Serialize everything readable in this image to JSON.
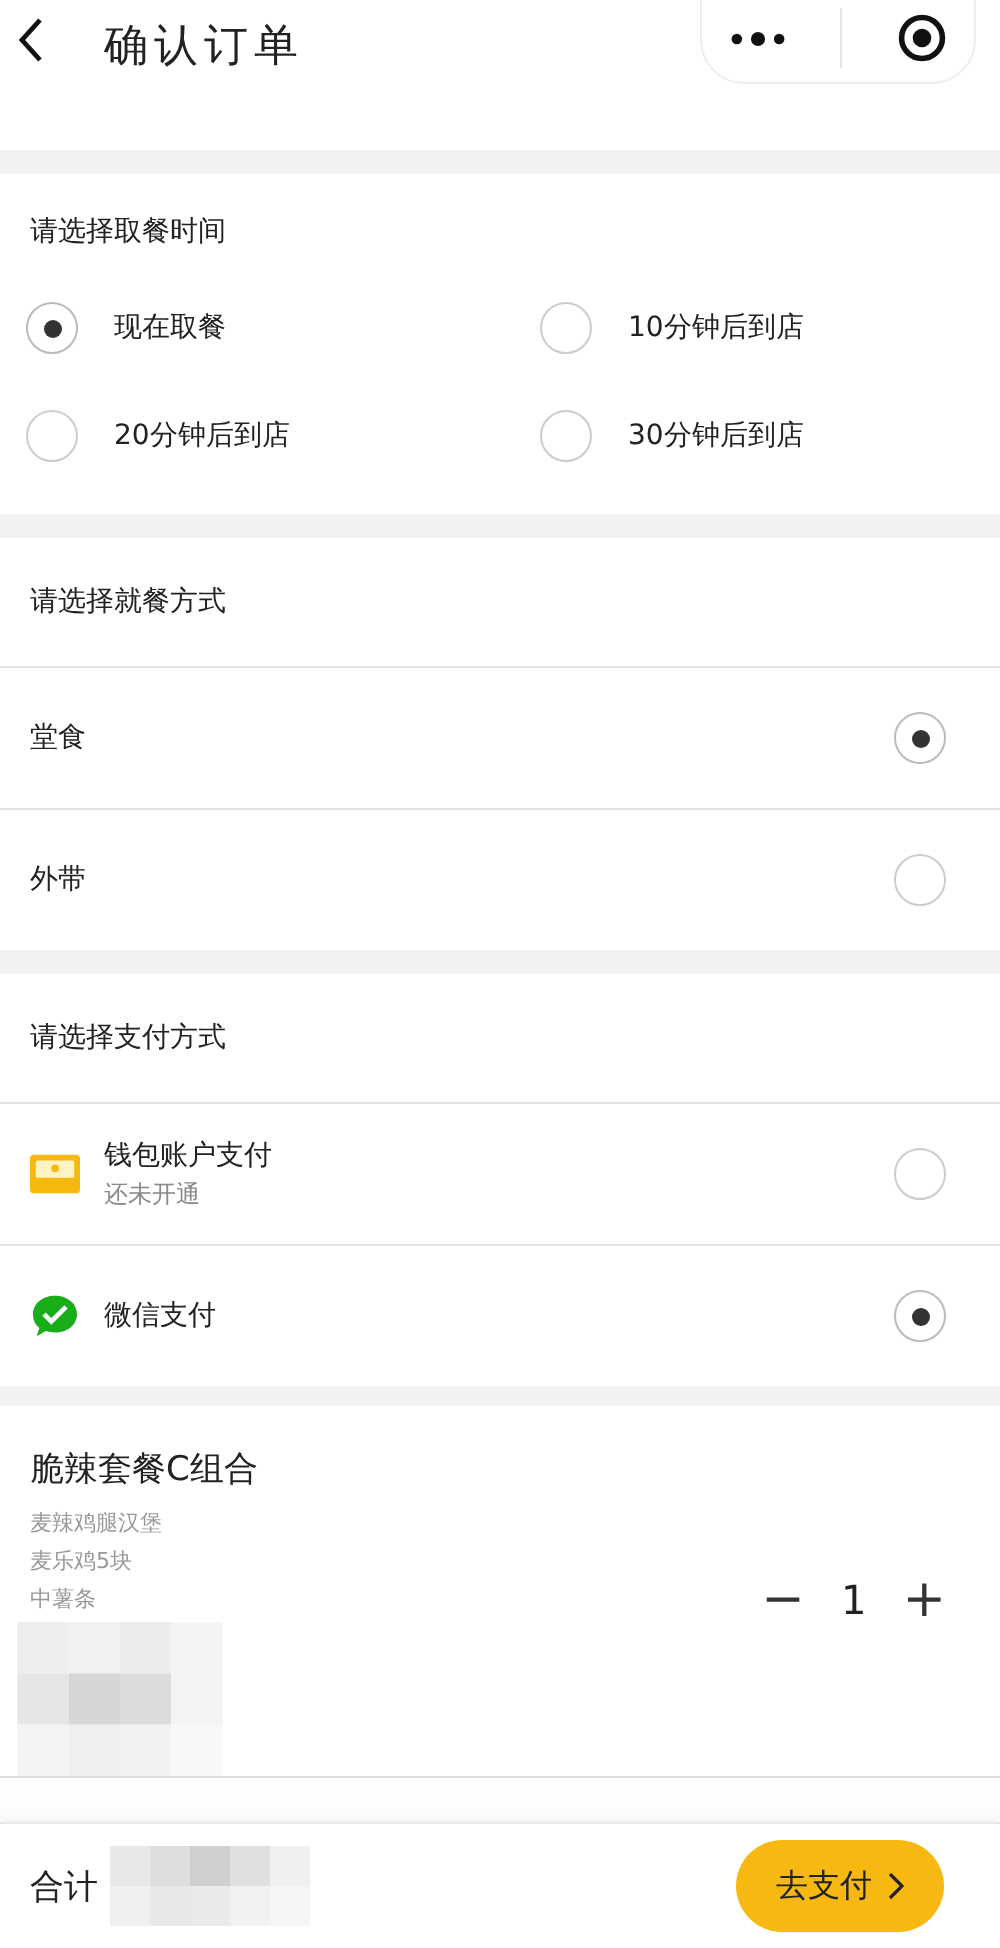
{
  "header": {
    "title": "确认订单"
  },
  "pickup_time": {
    "heading": "请选择取餐时间",
    "options": [
      {
        "label": "现在取餐",
        "selected": true
      },
      {
        "label": "10分钟后到店",
        "selected": false
      },
      {
        "label": "20分钟后到店",
        "selected": false
      },
      {
        "label": "30分钟后到店",
        "selected": false
      }
    ]
  },
  "dining_mode": {
    "heading": "请选择就餐方式",
    "options": [
      {
        "label": "堂食",
        "selected": true
      },
      {
        "label": "外带",
        "selected": false
      }
    ]
  },
  "payment": {
    "heading": "请选择支付方式",
    "options": [
      {
        "kind": "wallet",
        "label": "钱包账户支付",
        "note": "还未开通",
        "selected": false
      },
      {
        "kind": "wechat",
        "label": "微信支付",
        "selected": true
      }
    ]
  },
  "product": {
    "name": "脆辣套餐C组合",
    "items": [
      "麦辣鸡腿汉堡",
      "麦乐鸡5块",
      "中薯条"
    ],
    "quantity": "1",
    "minus": "−",
    "plus": "+"
  },
  "footer": {
    "total_label": "合计",
    "pay_button": "去支付"
  }
}
